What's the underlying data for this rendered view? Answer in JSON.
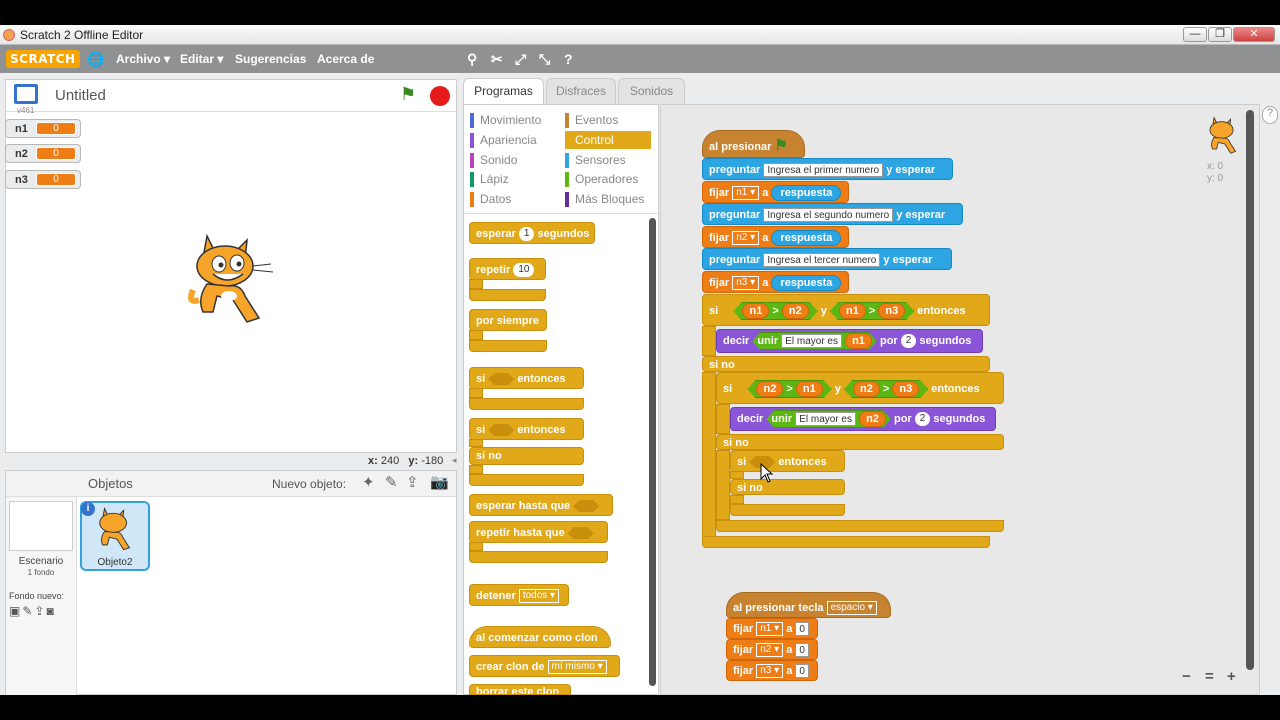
{
  "window": {
    "title": "Scratch 2 Offline Editor",
    "buttons": [
      "—",
      "❐",
      "✕"
    ]
  },
  "menubar": {
    "logo": "SCRATCH",
    "items": [
      "Archivo ▾",
      "Editar ▾",
      "Sugerencias",
      "Acerca de"
    ]
  },
  "stage": {
    "title": "Untitled",
    "version": "v461",
    "coords_x_label": "x:",
    "coords_x": "240",
    "coords_y_label": "y:",
    "coords_y": "-180"
  },
  "monitors": [
    {
      "name": "n1",
      "value": "0"
    },
    {
      "name": "n2",
      "value": "0"
    },
    {
      "name": "n3",
      "value": "0"
    }
  ],
  "sprites": {
    "header": "Objetos",
    "new_object": "Nuevo objeto:",
    "stage_label": "Escenario",
    "stage_sub": "1 fondo",
    "new_background": "Fondo nuevo:",
    "sprite_name": "Objeto2"
  },
  "tabs": [
    "Programas",
    "Disfraces",
    "Sonidos"
  ],
  "categories": {
    "left": [
      {
        "label": "Movimiento",
        "color": "#4a6cd4"
      },
      {
        "label": "Apariencia",
        "color": "#8a55d7"
      },
      {
        "label": "Sonido",
        "color": "#bb42c3"
      },
      {
        "label": "Lápiz",
        "color": "#0e9a6c"
      },
      {
        "label": "Datos",
        "color": "#ee7d16"
      }
    ],
    "right": [
      {
        "label": "Eventos",
        "color": "#c88330"
      },
      {
        "label": "Control",
        "color": "#e1a91a"
      },
      {
        "label": "Sensores",
        "color": "#2ca5e2"
      },
      {
        "label": "Operadores",
        "color": "#5cb712"
      },
      {
        "label": "Más Bloques",
        "color": "#632d99"
      }
    ]
  },
  "palette": {
    "wait": "esperar",
    "wait_num": "1",
    "wait_unit": "segundos",
    "repeat": "repetir",
    "repeat_num": "10",
    "forever": "por siempre",
    "if1": "si",
    "then1": "entonces",
    "if2": "si",
    "then2": "entonces",
    "else2": "si no",
    "wait_until": "esperar hasta que",
    "repeat_until": "repetir hasta que",
    "stop": "detener",
    "stop_opt": "todos ▾",
    "clone_start": "al comenzar como clon",
    "create_clone": "crear clon de",
    "clone_opt": "mí mismo ▾",
    "delete_clone": "borrar este clon"
  },
  "script1": {
    "hat": "al presionar",
    "ask1": "preguntar",
    "ask1_text": "Ingresa el primer numero",
    "ask1_wait": "y esperar",
    "set1": "fijar",
    "set1_var": "n1 ▾",
    "set1_to": "a",
    "set1_val": "respuesta",
    "ask2": "preguntar",
    "ask2_text": "Ingresa el segundo numero",
    "ask2_wait": "y esperar",
    "set2": "fijar",
    "set2_var": "n2 ▾",
    "set2_to": "a",
    "set2_val": "respuesta",
    "ask3": "preguntar",
    "ask3_text": "Ingresa el tercer numero",
    "ask3_wait": "y esperar",
    "set3": "fijar",
    "set3_var": "n3 ▾",
    "set3_to": "a",
    "set3_val": "respuesta",
    "if1": "si",
    "c1a": "n1",
    "gt1": ">",
    "c1b": "n2",
    "and1": "y",
    "c1c": "n1",
    "gt2": ">",
    "c1d": "n3",
    "then1": "entonces",
    "say1": "decir",
    "join1": "unir",
    "join1_text": "El mayor es",
    "join1_var": "n1",
    "for1": "por",
    "secs1": "2",
    "unit1": "segundos",
    "else1": "si no",
    "if2": "si",
    "c2a": "n2",
    "gt3": ">",
    "c2b": "n1",
    "and2": "y",
    "c2c": "n2",
    "gt4": ">",
    "c2d": "n3",
    "then2": "entonces",
    "say2": "decir",
    "join2": "unir",
    "join2_text": "El mayor es",
    "join2_var": "n2",
    "for2": "por",
    "secs2": "2",
    "unit2": "segundos",
    "else2": "si no",
    "if3": "si",
    "then3": "entonces",
    "else3": "si no"
  },
  "script2": {
    "hat": "al presionar tecla",
    "key": "espacio ▾",
    "set1": "fijar",
    "var1": "n1 ▾",
    "to1": "a",
    "val1": "0",
    "set2": "fijar",
    "var2": "n2 ▾",
    "to2": "a",
    "val2": "0",
    "set3": "fijar",
    "var3": "n3 ▾",
    "to3": "a",
    "val3": "0"
  },
  "sprite_info": {
    "x": "x: 0",
    "y": "y: 0"
  },
  "zoom": [
    "−",
    "=",
    "+"
  ]
}
